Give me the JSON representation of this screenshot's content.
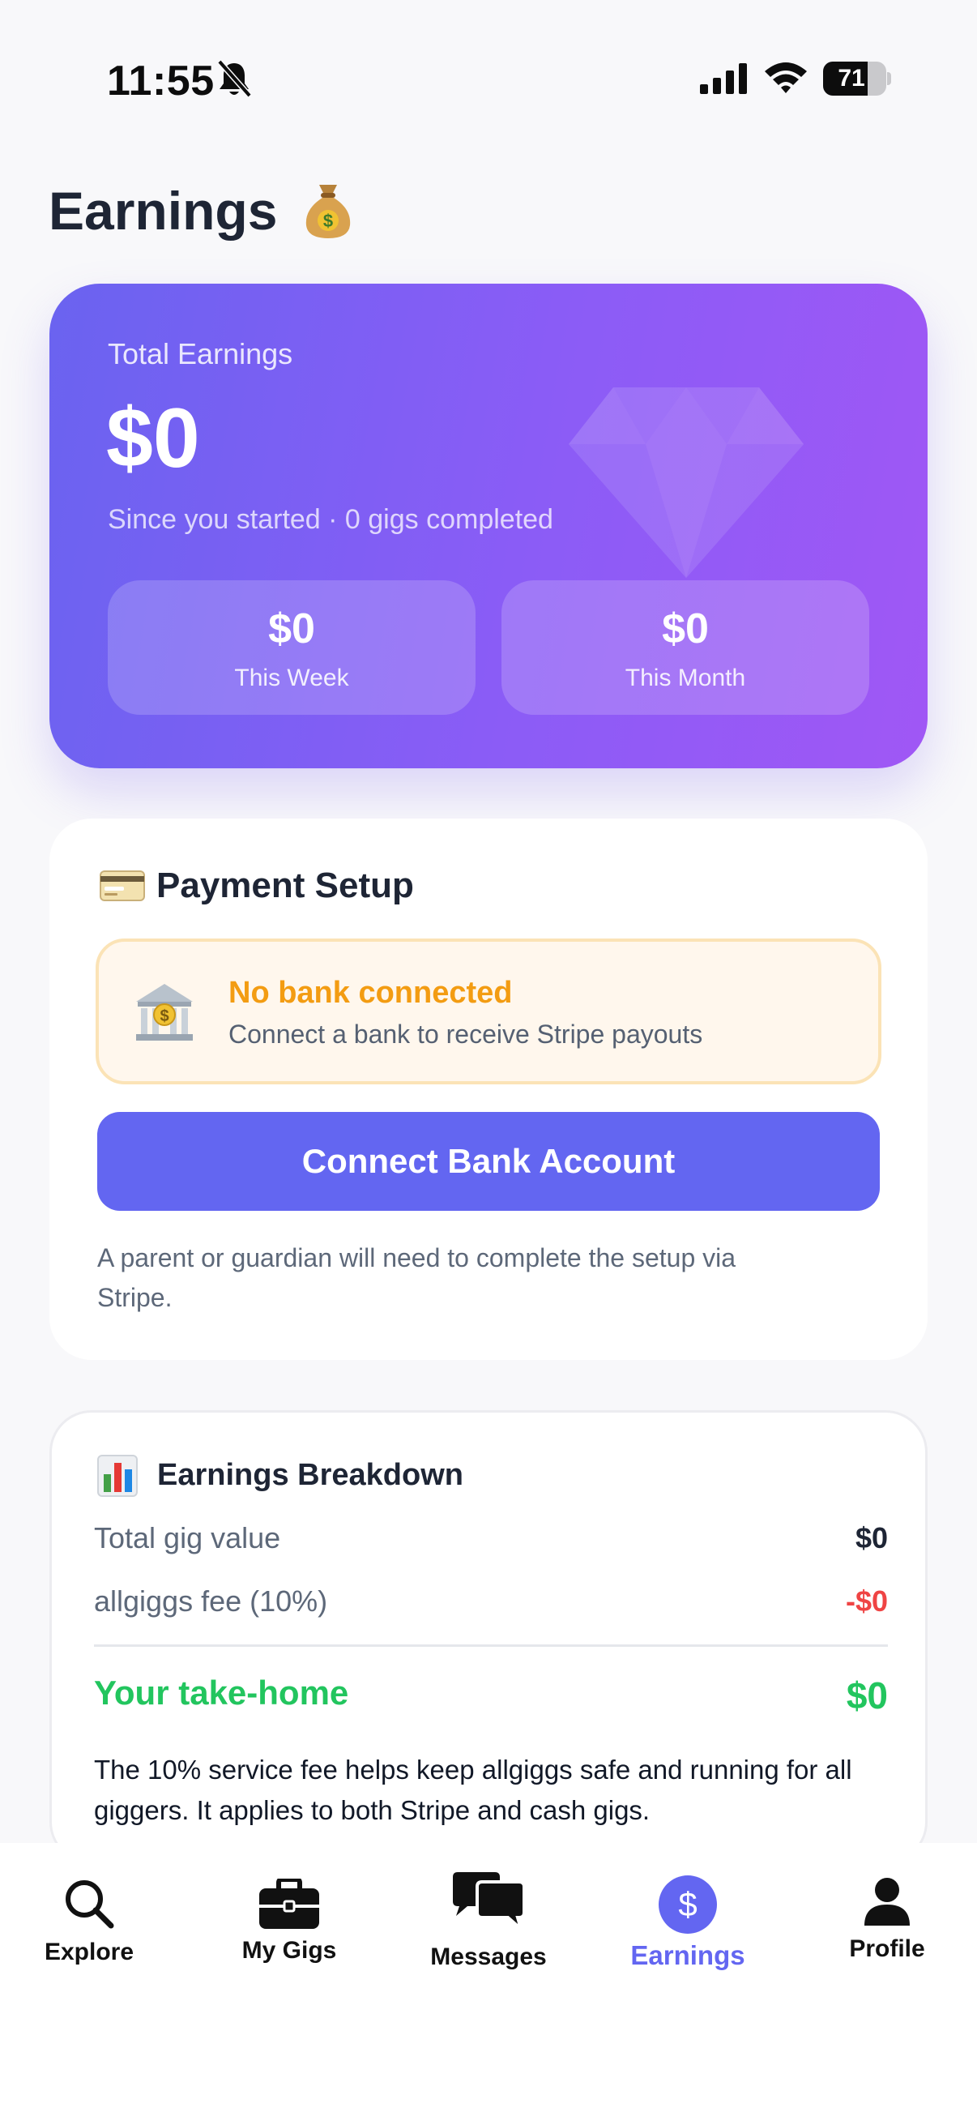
{
  "status_bar": {
    "time": "11:55",
    "battery": "71",
    "battery_level": 0.71
  },
  "header": {
    "title": "Earnings",
    "title_emoji": "money-bag-icon"
  },
  "summary": {
    "label": "Total Earnings",
    "amount": "$0",
    "subtitle": "Since you started · 0 gigs completed",
    "week": {
      "amount": "$0",
      "label": "This Week"
    },
    "month": {
      "amount": "$0",
      "label": "This Month"
    }
  },
  "payment_setup": {
    "title": "Payment Setup",
    "warning_title": "No bank connected",
    "warning_subtitle": "Connect a bank to receive Stripe payouts",
    "connect_label": "Connect Bank Account",
    "note": "A parent or guardian will need to complete the setup via Stripe."
  },
  "breakdown": {
    "title": "Earnings Breakdown",
    "total_label": "Total gig value",
    "total_value": "$0",
    "fee_label": "allgiggs fee (10%)",
    "fee_value": "-$0",
    "take_home_label": "Your take-home",
    "take_home_value": "$0",
    "note": "The 10% service fee helps keep allgiggs safe and running for all giggers. It applies to both Stripe and cash gigs."
  },
  "tabs": [
    {
      "label": "Explore",
      "icon": "search-icon"
    },
    {
      "label": "My Gigs",
      "icon": "briefcase-icon"
    },
    {
      "label": "Messages",
      "icon": "chat-bubbles-icon"
    },
    {
      "label": "Earnings",
      "icon": "dollar-icon",
      "active": true
    },
    {
      "label": "Profile",
      "icon": "person-icon"
    }
  ],
  "colors": {
    "accent": "#6366f1",
    "warning": "#f39c12",
    "negative": "#ef4444",
    "positive": "#22c55e"
  }
}
